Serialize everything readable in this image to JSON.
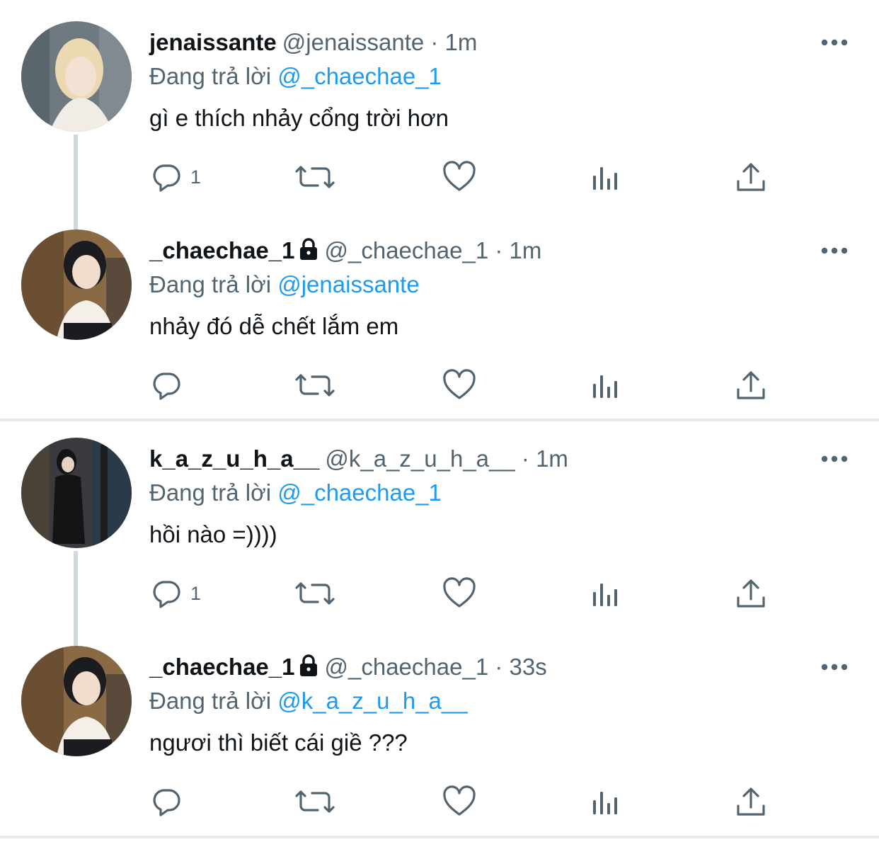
{
  "tweets": [
    {
      "name": "jenaissante",
      "handle": "@jenaissante",
      "time": "1m",
      "locked": false,
      "replying_to_prefix": "Đang trả lời",
      "replying_to": "@_chaechae_1",
      "content": "gì e thích nhảy cổng trời hơn",
      "reply_count": "1",
      "avatar_colors": [
        "#6f7a80",
        "#e9d8b8",
        "#f3e7d6"
      ]
    },
    {
      "name": "_chaechae_1",
      "handle": "@_chaechae_1",
      "time": "1m",
      "locked": true,
      "replying_to_prefix": "Đang trả lời",
      "replying_to": "@jenaissante",
      "content": "nhảy đó dễ chết lắm em",
      "reply_count": "",
      "avatar_colors": [
        "#8a6a45",
        "#1c1b1f",
        "#f0d9c6"
      ]
    },
    {
      "name": "k_a_z_u_h_a__",
      "handle": "@k_a_z_u_h_a__",
      "time": "1m",
      "locked": false,
      "replying_to_prefix": "Đang trả lời",
      "replying_to": "@_chaechae_1",
      "content": "hồi nào =))))",
      "reply_count": "1",
      "avatar_colors": [
        "#3b3a3f",
        "#141416",
        "#e6d2c2"
      ]
    },
    {
      "name": "_chaechae_1",
      "handle": "@_chaechae_1",
      "time": "33s",
      "locked": true,
      "replying_to_prefix": "Đang trả lời",
      "replying_to": "@k_a_z_u_h_a__",
      "content": "ngươi thì biết cái giề ???",
      "reply_count": "",
      "avatar_colors": [
        "#8a6a45",
        "#1c1b1f",
        "#f0d9c6"
      ]
    }
  ],
  "colors": {
    "text": "#0f1419",
    "secondary": "#536471",
    "link": "#1d9bf0",
    "thread_line": "#cfd9de",
    "divider": "#e7eaeb"
  },
  "icons": [
    "reply-icon",
    "retweet-icon",
    "like-icon",
    "views-icon",
    "share-icon",
    "more-icon",
    "lock-icon"
  ]
}
